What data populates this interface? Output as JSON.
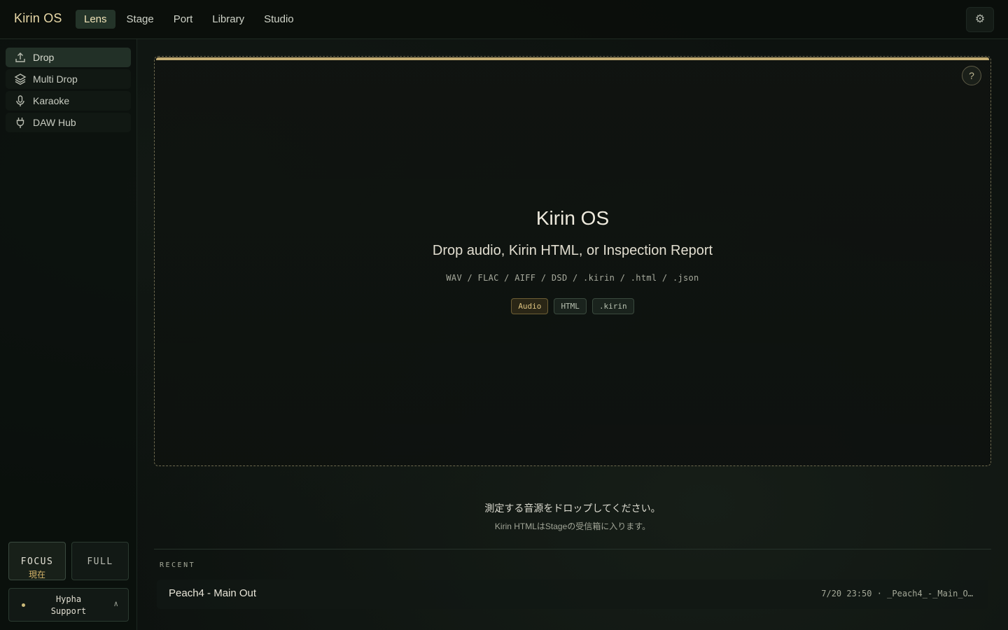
{
  "app": {
    "title": "Kirin OS"
  },
  "header": {
    "tabs": [
      {
        "label": "Lens",
        "active": true
      },
      {
        "label": "Stage",
        "active": false
      },
      {
        "label": "Port",
        "active": false
      },
      {
        "label": "Library",
        "active": false
      },
      {
        "label": "Studio",
        "active": false
      }
    ],
    "settings_icon": "⚙"
  },
  "sidebar": {
    "items": [
      {
        "label": "Drop",
        "icon": "upload-icon",
        "active": true
      },
      {
        "label": "Multi Drop",
        "icon": "layers-icon",
        "active": false
      },
      {
        "label": "Karaoke",
        "icon": "microphone-icon",
        "active": false
      },
      {
        "label": "DAW Hub",
        "icon": "plug-icon",
        "active": false
      }
    ],
    "modes": {
      "focus": {
        "label": "FOCUS",
        "sub": "現在"
      },
      "full": {
        "label": "FULL"
      }
    },
    "support": {
      "line1": "Hypha",
      "line2": "Support",
      "chevron": "∧"
    }
  },
  "dropzone": {
    "help": "?",
    "title": "Kirin OS",
    "subtitle": "Drop audio, Kirin HTML, or Inspection Report",
    "formats": "WAV / FLAC / AIFF / DSD / .kirin / .html / .json",
    "chips": [
      "Audio",
      "HTML",
      ".kirin"
    ]
  },
  "hint": {
    "main": "測定する音源をドロップしてください。",
    "sub": "Kirin HTMLはStageの受信箱に入ります。"
  },
  "recent": {
    "label": "RECENT",
    "items": [
      {
        "name": "Peach4 - Main Out",
        "meta": "7/20  23:50 · _Peach4_-_Main_O…"
      }
    ]
  },
  "colors": {
    "accent_gold": "#c4ad72",
    "active_tab_bg": "#243429",
    "background": "#0d120f"
  }
}
